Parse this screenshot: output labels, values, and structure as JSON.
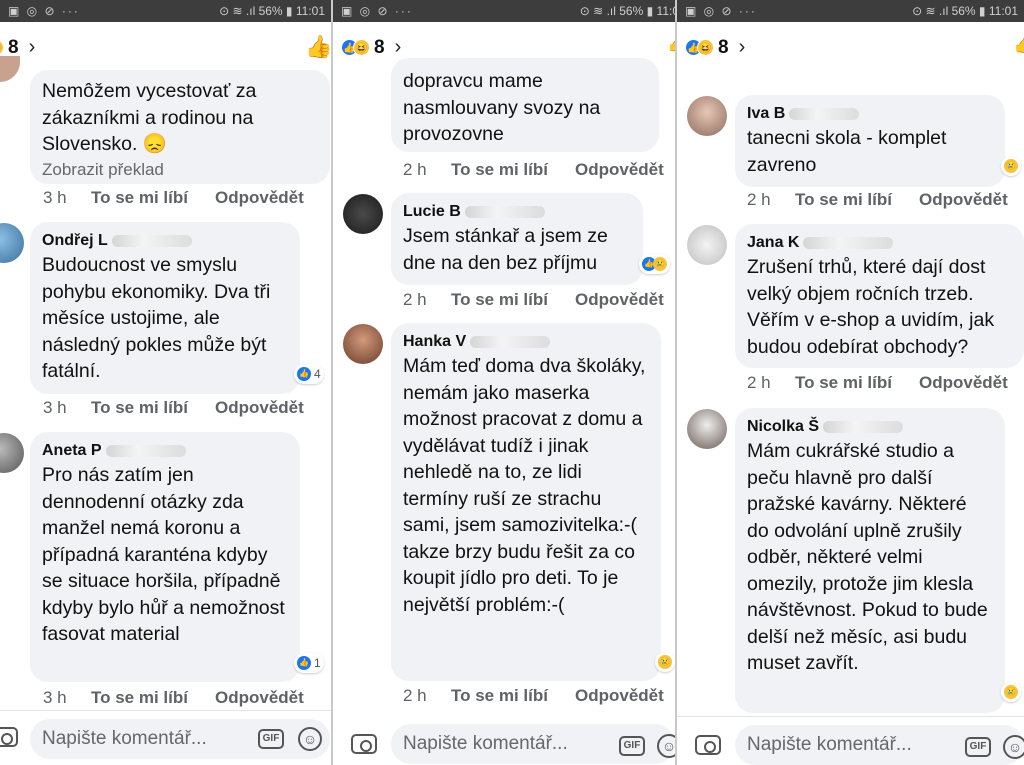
{
  "status": {
    "icons_left": "▣ ◎ ⊘ ···",
    "icons_right": "⊙ ≋ .ıl 56% ▮ 11:01",
    "icons_right_cut": "⊙ ≋ .ıl 56% ▮ 11:0"
  },
  "header": {
    "reaction_count": "8",
    "chevron": "›",
    "like_icon": "👍"
  },
  "actions": {
    "like": "To se mi líbí",
    "reply": "Odpovědět"
  },
  "composer": {
    "placeholder": "Napište komentář...",
    "gif": "GIF",
    "emoji": "☺"
  },
  "colors": {
    "accent": "#1877f2",
    "bubble": "#f0f2f5",
    "meta": "#65676b"
  },
  "panel1": {
    "c0": {
      "text": "Nemôžem vycestovať za zákazníkmi a rodinou na Slovensko. 😞",
      "translate": "Zobrazit překlad",
      "time": "3 h"
    },
    "c1": {
      "name": "Ondřej L",
      "text": "Budoucnost ve smyslu pohybu ekonomiky. Dva tři měsíce ustojime, ale následný pokles může být fatální.",
      "reactions": "4",
      "time": "3 h"
    },
    "c2": {
      "name": "Aneta P",
      "text": "Pro nás zatím jen dennodenní otázky zda manžel nemá koronu a případná karanténa kdyby se situace horšila, případně kdyby bylo hůř a nemožnost fasovat material",
      "reactions": "1",
      "time": "3 h"
    }
  },
  "panel2": {
    "c0": {
      "text": "dopravcu mame nasmlouvany svozy na provozovne",
      "time": "2 h"
    },
    "c1": {
      "name": "Lucie B",
      "text": "Jsem stánkař a jsem ze dne na den bez příjmu",
      "time": "2 h"
    },
    "c2": {
      "name": "Hanka V",
      "text": "Mám teď doma dva školáky, nemám jako maserka možnost pracovat z domu a vydělávat tudíž i jinak nehledě na to, ze lidi termíny ruší ze strachu sami, jsem samozivitelka:-( takze brzy budu řešit za co koupit jídlo pro deti. To je největší problém:-(",
      "time": "2 h"
    }
  },
  "panel3": {
    "c1": {
      "name": "Iva B",
      "text": "tanecni skola - komplet zavreno",
      "time": "2 h"
    },
    "c2": {
      "name": "Jana K",
      "text": "Zrušení trhů,  které dají dost velký objem ročních trzeb. Věřím v e-shop a uvidím,  jak budou odebírat obchody?",
      "time": "2 h"
    },
    "c3": {
      "name": "Nicolka Š",
      "text": "Mám cukrářské studio a peču hlavně pro další pražské kavárny. Některé do odvolání uplně zrušily odběr, některé velmi omezily, protože jim klesla návštěvnost. Pokud to bude delší než měsíc, asi budu muset zavřít."
    }
  }
}
